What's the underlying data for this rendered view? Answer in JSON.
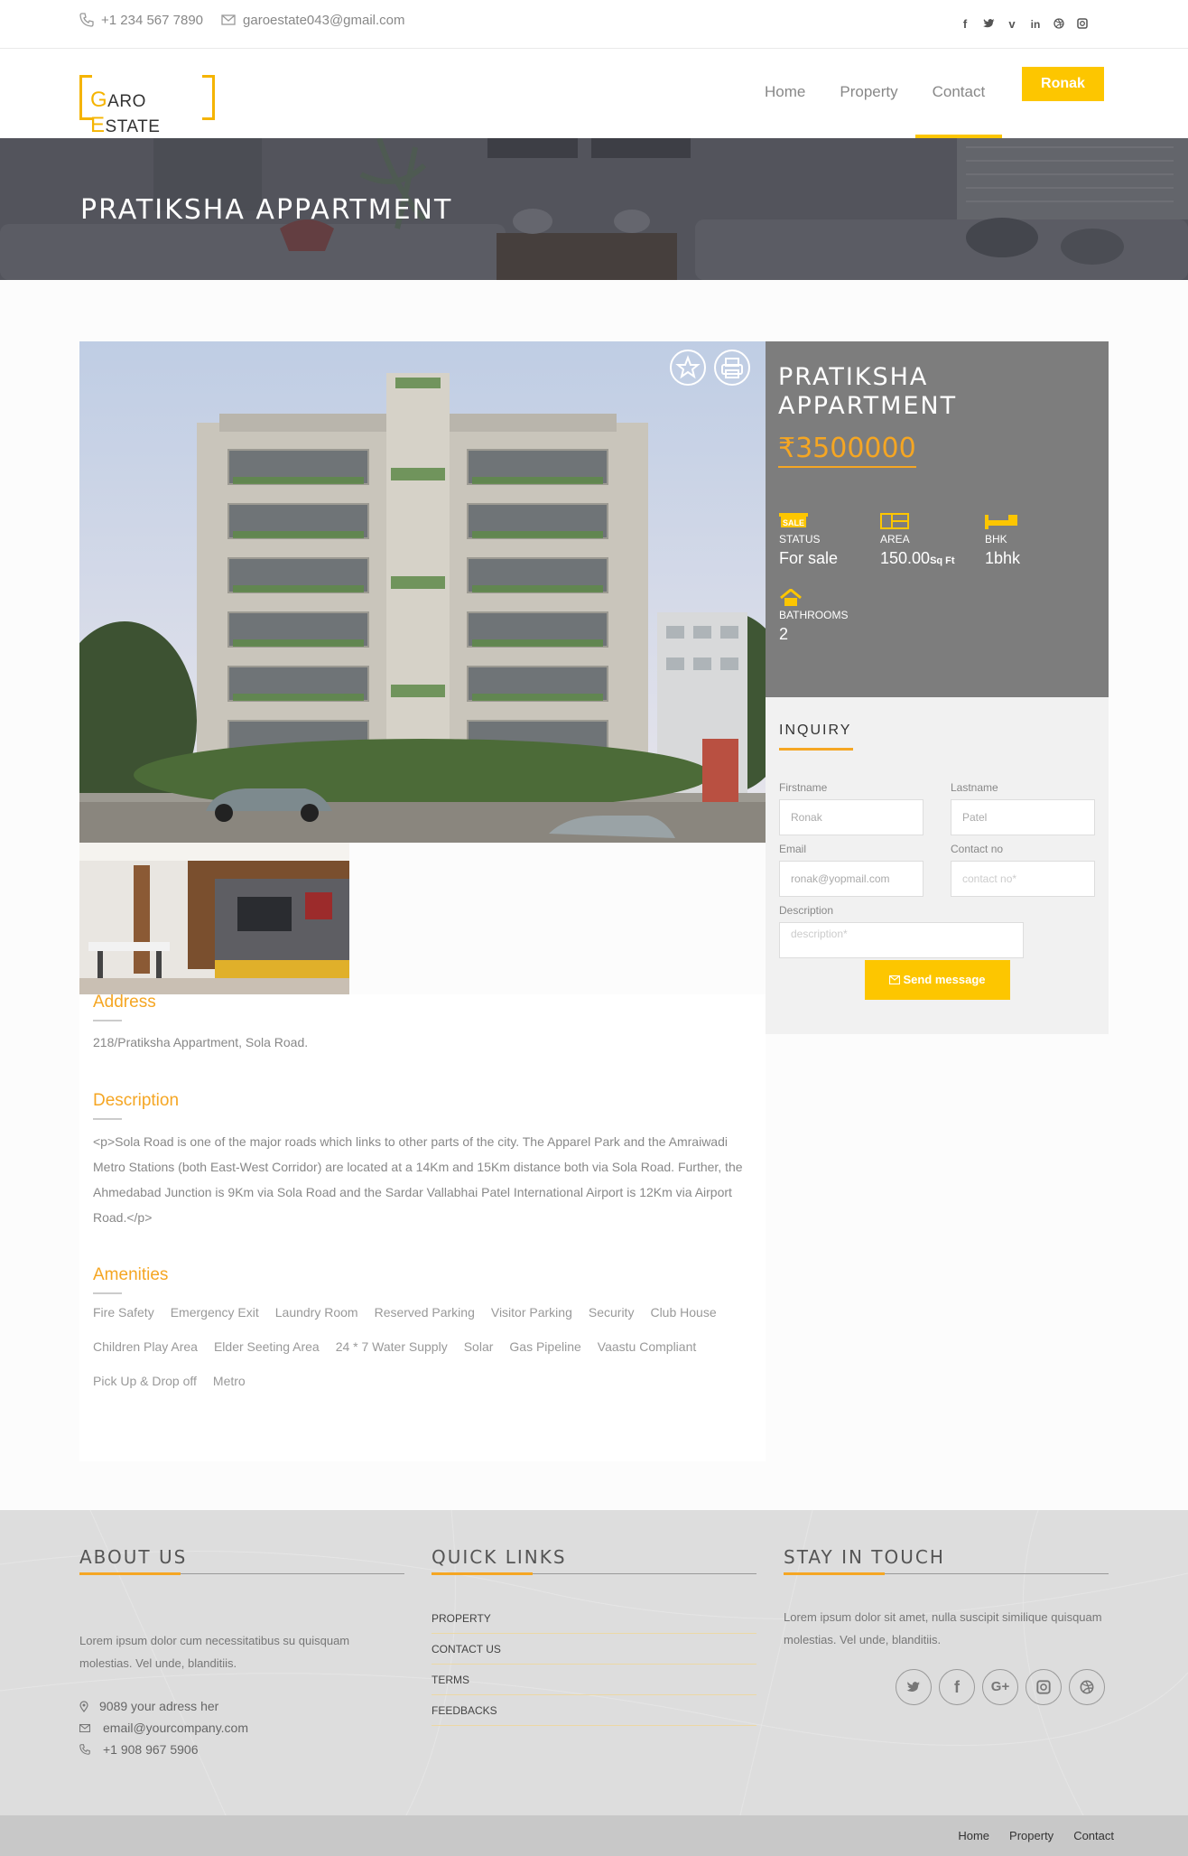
{
  "topbar": {
    "phone": "+1 234 567 7890",
    "email": "garoestate043@gmail.com",
    "social": [
      "f",
      "t",
      "v",
      "in",
      "dr",
      "ig"
    ]
  },
  "header": {
    "logo_g": "G",
    "logo_aro": "ARO ",
    "logo_e": "E",
    "logo_state": "STATE",
    "nav": [
      "Home",
      "Property",
      "Contact"
    ],
    "active_nav": "Contact",
    "user_button": "Ronak"
  },
  "hero": {
    "title": "PRATIKSHA APPARTMENT"
  },
  "property": {
    "address_title": "Address",
    "address": "218/Pratiksha Appartment, Sola Road.",
    "description_title": "Description",
    "description": "<p>Sola Road is one of the major roads which links to other parts of the city. The Apparel Park and the Amraiwadi Metro Stations (both East-West Corridor) are located at a 14Km and 15Km distance both via Sola Road. Further, the Ahmedabad Junction is 9Km via Sola Road and the Sardar Vallabhai Patel International Airport is 12Km via Airport Road.</p>",
    "amenities_title": "Amenities",
    "amenities": [
      "Fire Safety",
      "Emergency Exit",
      "Laundry Room",
      "Reserved Parking",
      "Visitor Parking",
      "Security",
      "Club House",
      "Children Play Area",
      "Elder Seeting Area",
      "24 * 7 Water Supply",
      "Solar",
      "Gas Pipeline",
      "Vaastu Compliant",
      "Pick Up & Drop off",
      "Metro"
    ]
  },
  "summary": {
    "title_line1": "PRATIKSHA",
    "title_line2": "APPARTMENT",
    "price": "₹3500000",
    "status_badge": "SALE",
    "status_label": "STATUS",
    "status_value": "For sale",
    "area_label": "AREA",
    "area_value": "150.00",
    "area_unit": "Sq Ft",
    "bhk_label": "BHK",
    "bhk_value": "1bhk",
    "bath_label": "BATHROOMS",
    "bath_value": "2"
  },
  "inquiry": {
    "title": "INQUIRY",
    "firstname_label": "Firstname",
    "firstname_value": "Ronak",
    "lastname_label": "Lastname",
    "lastname_value": "Patel",
    "email_label": "Email",
    "email_value": "ronak@yopmail.com",
    "contact_label": "Contact no",
    "contact_placeholder": "contact no*",
    "description_label": "Description",
    "description_placeholder": "description*",
    "send_label": "Send message"
  },
  "footer": {
    "about_title": "ABOUT US",
    "about_text": "Lorem ipsum dolor cum necessitatibus su quisquam molestias. Vel unde, blanditiis.",
    "address": "9089 your adress her",
    "email": "email@yourcompany.com",
    "phone": "+1 908 967 5906",
    "links_title": "QUICK LINKS",
    "links": [
      "PROPERTY",
      "CONTACT US",
      "TERMS",
      "FEEDBACKS"
    ],
    "touch_title": "STAY IN TOUCH",
    "touch_text": "Lorem ipsum dolor sit amet, nulla suscipit similique quisquam molestias. Vel unde, blanditiis.",
    "bottom_links": [
      "Home",
      "Property",
      "Contact"
    ]
  },
  "colors": {
    "accent": "#fdc600",
    "orange": "#f5a623",
    "panel": "#7d7d7d"
  }
}
